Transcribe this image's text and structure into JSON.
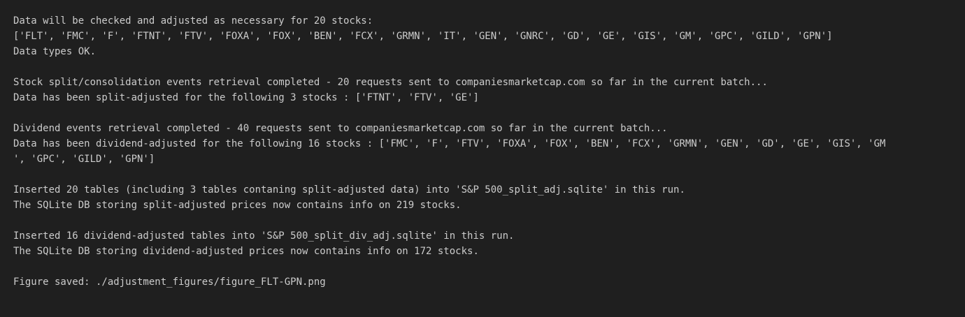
{
  "colors": {
    "background": "#1f1f1f",
    "text": "#cccccc"
  },
  "output": {
    "line_01": "Data will be checked and adjusted as necessary for 20 stocks:",
    "line_02": "['FLT', 'FMC', 'F', 'FTNT', 'FTV', 'FOXA', 'FOX', 'BEN', 'FCX', 'GRMN', 'IT', 'GEN', 'GNRC', 'GD', 'GE', 'GIS', 'GM', 'GPC', 'GILD', 'GPN']",
    "line_03": "Data types OK.",
    "line_04": "Stock split/consolidation events retrieval completed - 20 requests sent to companiesmarketcap.com so far in the current batch...",
    "line_05": "Data has been split-adjusted for the following 3 stocks : ['FTNT', 'FTV', 'GE']",
    "line_06": "Dividend events retrieval completed - 40 requests sent to companiesmarketcap.com so far in the current batch...",
    "line_07": "Data has been dividend-adjusted for the following 16 stocks : ['FMC', 'F', 'FTV', 'FOXA', 'FOX', 'BEN', 'FCX', 'GRMN', 'GEN', 'GD', 'GE', 'GIS', 'GM",
    "line_08": "', 'GPC', 'GILD', 'GPN']",
    "line_09": "Inserted 20 tables (including 3 tables contaning split-adjusted data) into 'S&P 500_split_adj.sqlite' in this run.",
    "line_10": "The SQLite DB storing split-adjusted prices now contains info on 219 stocks.",
    "line_11": "Inserted 16 dividend-adjusted tables into 'S&P 500_split_div_adj.sqlite' in this run.",
    "line_12": "The SQLite DB storing dividend-adjusted prices now contains info on 172 stocks.",
    "line_13": "Figure saved: ./adjustment_figures/figure_FLT-GPN.png"
  }
}
